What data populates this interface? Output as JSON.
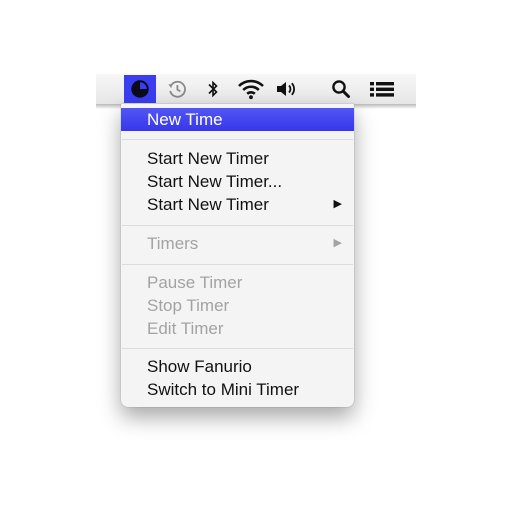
{
  "menubar": {
    "icons": [
      {
        "name": "fanurio-timer-icon"
      },
      {
        "name": "time-machine-icon"
      },
      {
        "name": "bluetooth-icon"
      },
      {
        "name": "wifi-icon"
      },
      {
        "name": "volume-icon"
      },
      {
        "name": "spotlight-search-icon"
      },
      {
        "name": "notification-center-icon"
      }
    ],
    "accent_color": "#3b3cf0"
  },
  "menu": {
    "items": [
      {
        "label": "New Time",
        "enabled": true,
        "highlighted": true
      },
      {
        "label": "Start New Timer",
        "enabled": true
      },
      {
        "label": "Start New Timer...",
        "enabled": true
      },
      {
        "label": "Start New Timer",
        "enabled": true,
        "submenu_arrow": "▶"
      },
      {
        "label": "Timers",
        "enabled": false,
        "submenu_arrow": "▶"
      },
      {
        "label": "Pause Timer",
        "enabled": false
      },
      {
        "label": "Stop Timer",
        "enabled": false
      },
      {
        "label": "Edit Timer",
        "enabled": false
      },
      {
        "label": "Show Fanurio",
        "enabled": true
      },
      {
        "label": "Switch to Mini Timer",
        "enabled": true
      }
    ]
  }
}
